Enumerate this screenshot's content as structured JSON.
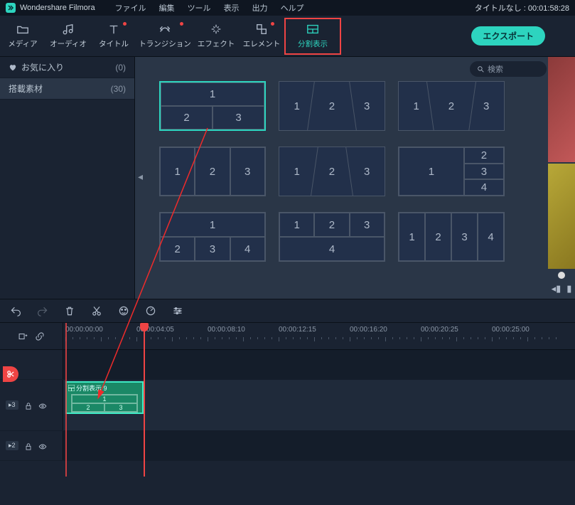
{
  "title": {
    "app": "Wondershare Filmora",
    "project": "タイトルなし",
    "timecode": "00:01:58:28"
  },
  "menu": {
    "file": "ファイル",
    "edit": "編集",
    "tool": "ツール",
    "view": "表示",
    "output": "出力",
    "help": "ヘルプ"
  },
  "tools": {
    "media": "メディア",
    "audio": "オーディオ",
    "title": "タイトル",
    "transition": "トランジション",
    "effect": "エフェクト",
    "element": "エレメント",
    "split": "分割表示"
  },
  "export_label": "エクスポート",
  "sidebar": {
    "fav": "お気に入り",
    "fav_count": "(0)",
    "pack": "搭載素材",
    "pack_count": "(30)"
  },
  "search_placeholder": "検索",
  "ruler": {
    "t0": "00:00:00:00",
    "t1": "00:00:04:05",
    "t2": "00:00:08:10",
    "t3": "00:00:12:15",
    "t4": "00:00:16:20",
    "t5": "00:00:20:25",
    "t6": "00:00:25:00"
  },
  "tracks": {
    "v3": "3",
    "v2": "2"
  },
  "clip": {
    "name": "分割表示 9"
  },
  "templates": {
    "a": [
      "1",
      "2",
      "3"
    ],
    "b": [
      "1",
      "2",
      "3"
    ],
    "c": [
      "1",
      "2",
      "3"
    ],
    "d": [
      "1",
      "2",
      "3"
    ],
    "e": [
      "1",
      "2",
      "3"
    ],
    "f": [
      "1",
      "2",
      "3",
      "4"
    ],
    "g": [
      "1",
      "2",
      "3",
      "4"
    ],
    "h": [
      "1",
      "2",
      "3",
      "4"
    ],
    "i": [
      "1",
      "2",
      "3",
      "4"
    ]
  }
}
